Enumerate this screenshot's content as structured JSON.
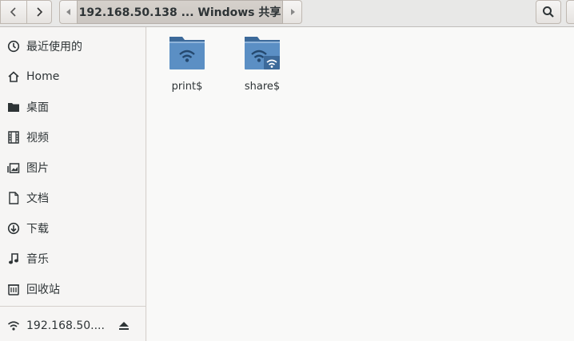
{
  "toolbar": {
    "back_icon": "chevron-left",
    "forward_icon": "chevron-right",
    "path_scroll_left_icon": "triangle-left",
    "path_scroll_right_icon": "triangle-right",
    "breadcrumb_label": "192.168.50.138 ... Windows 共享",
    "search_icon": "magnifier"
  },
  "sidebar": {
    "items": [
      {
        "label": "最近使用的",
        "icon": "clock"
      },
      {
        "label": "Home",
        "icon": "home"
      },
      {
        "label": "桌面",
        "icon": "folder"
      },
      {
        "label": "视频",
        "icon": "film"
      },
      {
        "label": "图片",
        "icon": "image"
      },
      {
        "label": "文档",
        "icon": "document"
      },
      {
        "label": "下载",
        "icon": "download"
      },
      {
        "label": "音乐",
        "icon": "music-note"
      },
      {
        "label": "回收站",
        "icon": "trash"
      }
    ],
    "mount": {
      "label": "192.168.50....",
      "icon": "wifi",
      "action_icon": "eject"
    }
  },
  "files": [
    {
      "name": "print$",
      "icon": "network-folder"
    },
    {
      "name": "share$",
      "icon": "network-folder-shared"
    }
  ],
  "colors": {
    "folder_body": "#5b8fc4",
    "folder_tab": "#3d6a9a",
    "sidebar_bg": "#f6f5f4",
    "view_bg": "#f9f9f8"
  }
}
